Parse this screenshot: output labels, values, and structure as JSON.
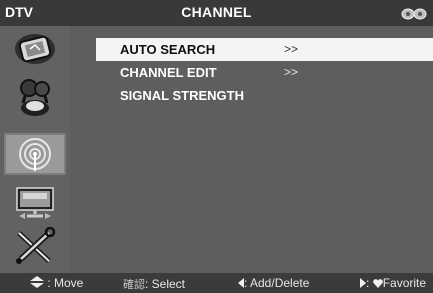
{
  "header": {
    "source": "DTV",
    "title": "CHANNEL"
  },
  "sidebar": {
    "items": [
      {
        "icon": "picture-icon"
      },
      {
        "icon": "sound-icon"
      },
      {
        "icon": "channel-icon",
        "active": true
      },
      {
        "icon": "display-icon"
      },
      {
        "icon": "setup-icon"
      }
    ]
  },
  "menu": {
    "items": [
      {
        "label": "AUTO SEARCH",
        "arrow": ">>",
        "selected": true
      },
      {
        "label": "CHANNEL EDIT",
        "arrow": ">>"
      },
      {
        "label": "SIGNAL STRENGTH",
        "arrow": ""
      }
    ]
  },
  "hints": {
    "move": ": Move",
    "select_prefix": "確認",
    "select": ": Select",
    "add_delete": ": Add/Delete",
    "favorite": "Favorite"
  }
}
